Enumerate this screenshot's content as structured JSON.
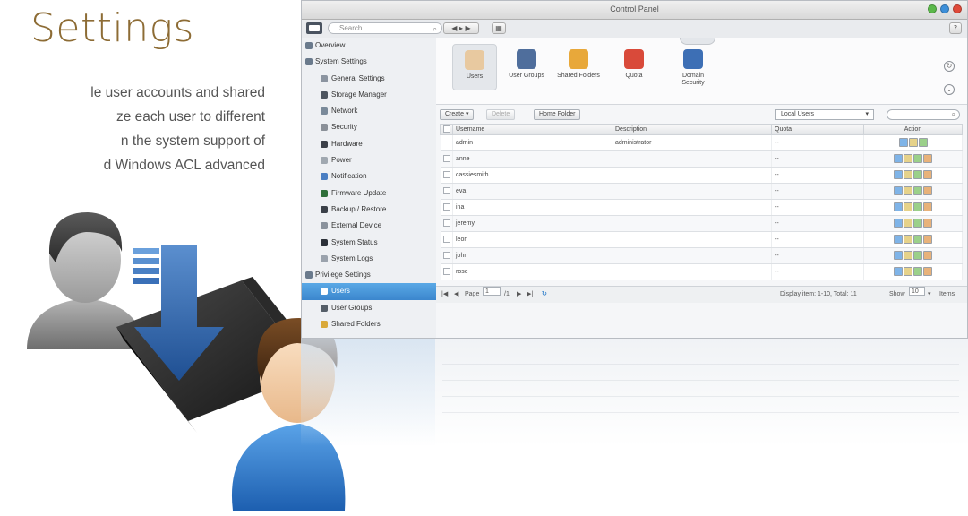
{
  "hero": {
    "title": "Settings",
    "lines": [
      "le user accounts and shared",
      "ze each user to different",
      "n the system support of",
      "d Windows ACL advanced"
    ]
  },
  "window": {
    "title": "Control Panel",
    "search_placeholder": "Search"
  },
  "sidebar": {
    "items": [
      {
        "label": "Overview",
        "level": 0,
        "icon": "overview-icon",
        "color": "#6a7a8c"
      },
      {
        "label": "System Settings",
        "level": 0,
        "icon": "gear-icon",
        "color": "#6a7a8c"
      },
      {
        "label": "General Settings",
        "level": 1,
        "icon": "settings-icon",
        "color": "#8b94a0"
      },
      {
        "label": "Storage Manager",
        "level": 1,
        "icon": "storage-icon",
        "color": "#4d5560"
      },
      {
        "label": "Network",
        "level": 1,
        "icon": "network-icon",
        "color": "#7a8a9a"
      },
      {
        "label": "Security",
        "level": 1,
        "icon": "lock-icon",
        "color": "#8a9098"
      },
      {
        "label": "Hardware",
        "level": 1,
        "icon": "hardware-icon",
        "color": "#3b4048"
      },
      {
        "label": "Power",
        "level": 1,
        "icon": "power-icon",
        "color": "#a0a8b0"
      },
      {
        "label": "Notification",
        "level": 1,
        "icon": "notification-icon",
        "color": "#4a7ec2"
      },
      {
        "label": "Firmware Update",
        "level": 1,
        "icon": "firmware-icon",
        "color": "#2f6f3a"
      },
      {
        "label": "Backup / Restore",
        "level": 1,
        "icon": "backup-icon",
        "color": "#3a4048"
      },
      {
        "label": "External Device",
        "level": 1,
        "icon": "external-device-icon",
        "color": "#8a929c"
      },
      {
        "label": "System Status",
        "level": 1,
        "icon": "monitor-icon",
        "color": "#2b3038"
      },
      {
        "label": "System Logs",
        "level": 1,
        "icon": "logs-icon",
        "color": "#9aa2ac"
      },
      {
        "label": "Privilege Settings",
        "level": 0,
        "icon": "user-icon",
        "color": "#6a7a8c"
      },
      {
        "label": "Users",
        "level": 1,
        "icon": "users-icon",
        "color": "#ffffff",
        "active": true
      },
      {
        "label": "User Groups",
        "level": 1,
        "icon": "user-groups-icon",
        "color": "#555e68"
      },
      {
        "label": "Shared Folders",
        "level": 1,
        "icon": "folder-icon",
        "color": "#d9a93a"
      }
    ]
  },
  "apps": [
    {
      "label": "Users",
      "icon": "users-icon",
      "color": "#e8c9a0",
      "selected": true
    },
    {
      "label": "User Groups",
      "icon": "user-groups-icon",
      "color": "#4f6e9c"
    },
    {
      "label": "Shared Folders",
      "icon": "folder-icon",
      "color": "#e8a83a"
    },
    {
      "label": "Quota",
      "icon": "quota-icon",
      "color": "#d94a3a"
    },
    {
      "label": "Domain Security",
      "icon": "domain-security-icon",
      "color": "#3d6fb5"
    }
  ],
  "grid_toolbar": {
    "create": "Create",
    "delete": "Delete",
    "home_folder": "Home Folder",
    "filter": "Local Users"
  },
  "table": {
    "columns": [
      "Username",
      "Description",
      "Quota",
      "Action"
    ],
    "rows": [
      {
        "username": "admin",
        "description": "administrator",
        "quota": "--",
        "checkbox": false
      },
      {
        "username": "anne",
        "description": "",
        "quota": "--",
        "checkbox": true
      },
      {
        "username": "cassiesmith",
        "description": "",
        "quota": "--",
        "checkbox": true
      },
      {
        "username": "eva",
        "description": "",
        "quota": "--",
        "checkbox": true
      },
      {
        "username": "ina",
        "description": "",
        "quota": "--",
        "checkbox": true
      },
      {
        "username": "jeremy",
        "description": "",
        "quota": "--",
        "checkbox": true
      },
      {
        "username": "leon",
        "description": "",
        "quota": "--",
        "checkbox": true
      },
      {
        "username": "john",
        "description": "",
        "quota": "--",
        "checkbox": true
      },
      {
        "username": "rose",
        "description": "",
        "quota": "--",
        "checkbox": true
      }
    ]
  },
  "pager": {
    "page_label": "Page",
    "page_value": "1",
    "of_label": "/1",
    "display": "Display item: 1-10, Total: 11",
    "show_label": "Show",
    "show_value": "10",
    "items_label": "Items"
  },
  "colors": {
    "title": "#8d6c35",
    "active_blue": "#3b86cd"
  }
}
